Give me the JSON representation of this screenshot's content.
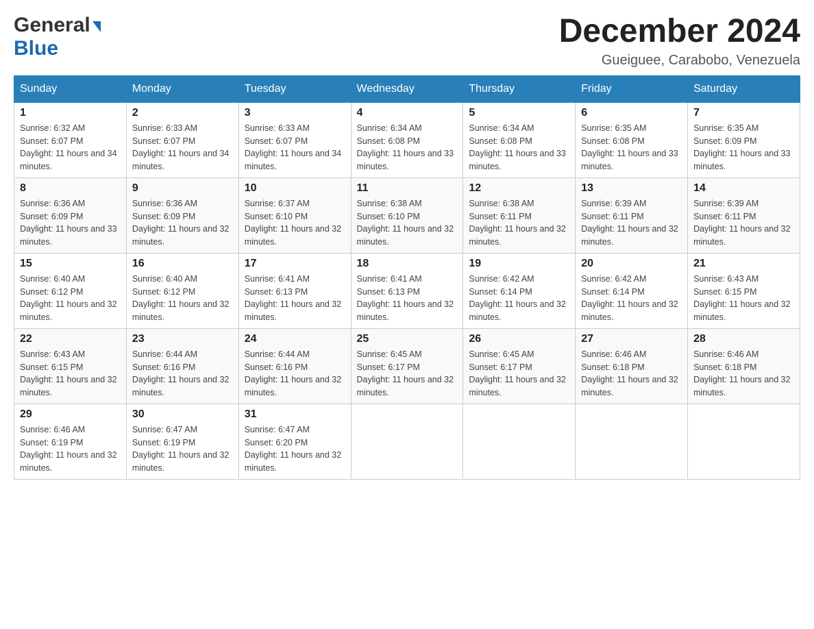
{
  "header": {
    "logo_general": "General",
    "logo_blue": "Blue",
    "title": "December 2024",
    "location": "Gueiguee, Carabobo, Venezuela"
  },
  "days_of_week": [
    "Sunday",
    "Monday",
    "Tuesday",
    "Wednesday",
    "Thursday",
    "Friday",
    "Saturday"
  ],
  "weeks": [
    [
      {
        "day": "1",
        "sunrise": "6:32 AM",
        "sunset": "6:07 PM",
        "daylight": "11 hours and 34 minutes."
      },
      {
        "day": "2",
        "sunrise": "6:33 AM",
        "sunset": "6:07 PM",
        "daylight": "11 hours and 34 minutes."
      },
      {
        "day": "3",
        "sunrise": "6:33 AM",
        "sunset": "6:07 PM",
        "daylight": "11 hours and 34 minutes."
      },
      {
        "day": "4",
        "sunrise": "6:34 AM",
        "sunset": "6:08 PM",
        "daylight": "11 hours and 33 minutes."
      },
      {
        "day": "5",
        "sunrise": "6:34 AM",
        "sunset": "6:08 PM",
        "daylight": "11 hours and 33 minutes."
      },
      {
        "day": "6",
        "sunrise": "6:35 AM",
        "sunset": "6:08 PM",
        "daylight": "11 hours and 33 minutes."
      },
      {
        "day": "7",
        "sunrise": "6:35 AM",
        "sunset": "6:09 PM",
        "daylight": "11 hours and 33 minutes."
      }
    ],
    [
      {
        "day": "8",
        "sunrise": "6:36 AM",
        "sunset": "6:09 PM",
        "daylight": "11 hours and 33 minutes."
      },
      {
        "day": "9",
        "sunrise": "6:36 AM",
        "sunset": "6:09 PM",
        "daylight": "11 hours and 32 minutes."
      },
      {
        "day": "10",
        "sunrise": "6:37 AM",
        "sunset": "6:10 PM",
        "daylight": "11 hours and 32 minutes."
      },
      {
        "day": "11",
        "sunrise": "6:38 AM",
        "sunset": "6:10 PM",
        "daylight": "11 hours and 32 minutes."
      },
      {
        "day": "12",
        "sunrise": "6:38 AM",
        "sunset": "6:11 PM",
        "daylight": "11 hours and 32 minutes."
      },
      {
        "day": "13",
        "sunrise": "6:39 AM",
        "sunset": "6:11 PM",
        "daylight": "11 hours and 32 minutes."
      },
      {
        "day": "14",
        "sunrise": "6:39 AM",
        "sunset": "6:11 PM",
        "daylight": "11 hours and 32 minutes."
      }
    ],
    [
      {
        "day": "15",
        "sunrise": "6:40 AM",
        "sunset": "6:12 PM",
        "daylight": "11 hours and 32 minutes."
      },
      {
        "day": "16",
        "sunrise": "6:40 AM",
        "sunset": "6:12 PM",
        "daylight": "11 hours and 32 minutes."
      },
      {
        "day": "17",
        "sunrise": "6:41 AM",
        "sunset": "6:13 PM",
        "daylight": "11 hours and 32 minutes."
      },
      {
        "day": "18",
        "sunrise": "6:41 AM",
        "sunset": "6:13 PM",
        "daylight": "11 hours and 32 minutes."
      },
      {
        "day": "19",
        "sunrise": "6:42 AM",
        "sunset": "6:14 PM",
        "daylight": "11 hours and 32 minutes."
      },
      {
        "day": "20",
        "sunrise": "6:42 AM",
        "sunset": "6:14 PM",
        "daylight": "11 hours and 32 minutes."
      },
      {
        "day": "21",
        "sunrise": "6:43 AM",
        "sunset": "6:15 PM",
        "daylight": "11 hours and 32 minutes."
      }
    ],
    [
      {
        "day": "22",
        "sunrise": "6:43 AM",
        "sunset": "6:15 PM",
        "daylight": "11 hours and 32 minutes."
      },
      {
        "day": "23",
        "sunrise": "6:44 AM",
        "sunset": "6:16 PM",
        "daylight": "11 hours and 32 minutes."
      },
      {
        "day": "24",
        "sunrise": "6:44 AM",
        "sunset": "6:16 PM",
        "daylight": "11 hours and 32 minutes."
      },
      {
        "day": "25",
        "sunrise": "6:45 AM",
        "sunset": "6:17 PM",
        "daylight": "11 hours and 32 minutes."
      },
      {
        "day": "26",
        "sunrise": "6:45 AM",
        "sunset": "6:17 PM",
        "daylight": "11 hours and 32 minutes."
      },
      {
        "day": "27",
        "sunrise": "6:46 AM",
        "sunset": "6:18 PM",
        "daylight": "11 hours and 32 minutes."
      },
      {
        "day": "28",
        "sunrise": "6:46 AM",
        "sunset": "6:18 PM",
        "daylight": "11 hours and 32 minutes."
      }
    ],
    [
      {
        "day": "29",
        "sunrise": "6:46 AM",
        "sunset": "6:19 PM",
        "daylight": "11 hours and 32 minutes."
      },
      {
        "day": "30",
        "sunrise": "6:47 AM",
        "sunset": "6:19 PM",
        "daylight": "11 hours and 32 minutes."
      },
      {
        "day": "31",
        "sunrise": "6:47 AM",
        "sunset": "6:20 PM",
        "daylight": "11 hours and 32 minutes."
      },
      null,
      null,
      null,
      null
    ]
  ],
  "labels": {
    "sunrise": "Sunrise:",
    "sunset": "Sunset:",
    "daylight": "Daylight:"
  },
  "colors": {
    "header_bg": "#2980b9",
    "accent": "#1a6ab1"
  }
}
